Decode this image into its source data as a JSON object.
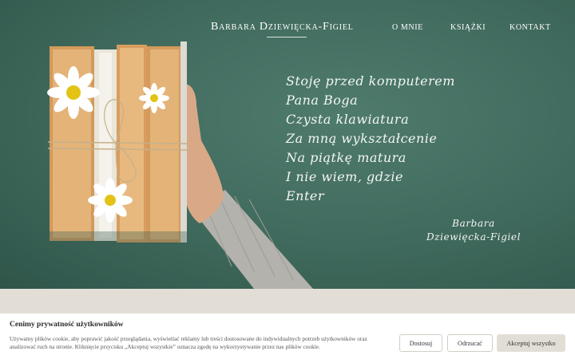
{
  "colors": {
    "hero_background": "#3f695c",
    "page_background": "#e2ded6",
    "accept_button": "#e2ded6",
    "text_light": "#ffffff"
  },
  "header": {
    "brand": "Barbara Dziewięcka-Figiel",
    "nav": [
      "O MNIE",
      "KSIĄŻKI",
      "KONTAKT"
    ]
  },
  "hero": {
    "poem": [
      "Stoję przed komputerem",
      "Pana Boga",
      "Czysta klawiatura",
      "Za mną wykształcenie",
      "Na piątkę matura",
      "I nie wiem, gdzie",
      "Enter"
    ],
    "signature": [
      "Barbara",
      "Dziewięcka-Figiel"
    ]
  },
  "cookie_banner": {
    "title": "Cenimy prywatność użytkowników",
    "text": "Używamy plików cookie, aby poprawić jakość przeglądania, wyświetlać reklamy lub treści dostosowane do indywidualnych potrzeb użytkowników oraz analizować ruch na stronie. Kliknięcie przycisku „Akceptuj wszystkie” oznacza zgodę na wykorzystywanie przez nas plików cookie.",
    "buttons": {
      "customize": "Dostosuj",
      "reject": "Odrzucać",
      "accept": "Akceptuj wszystko"
    }
  }
}
